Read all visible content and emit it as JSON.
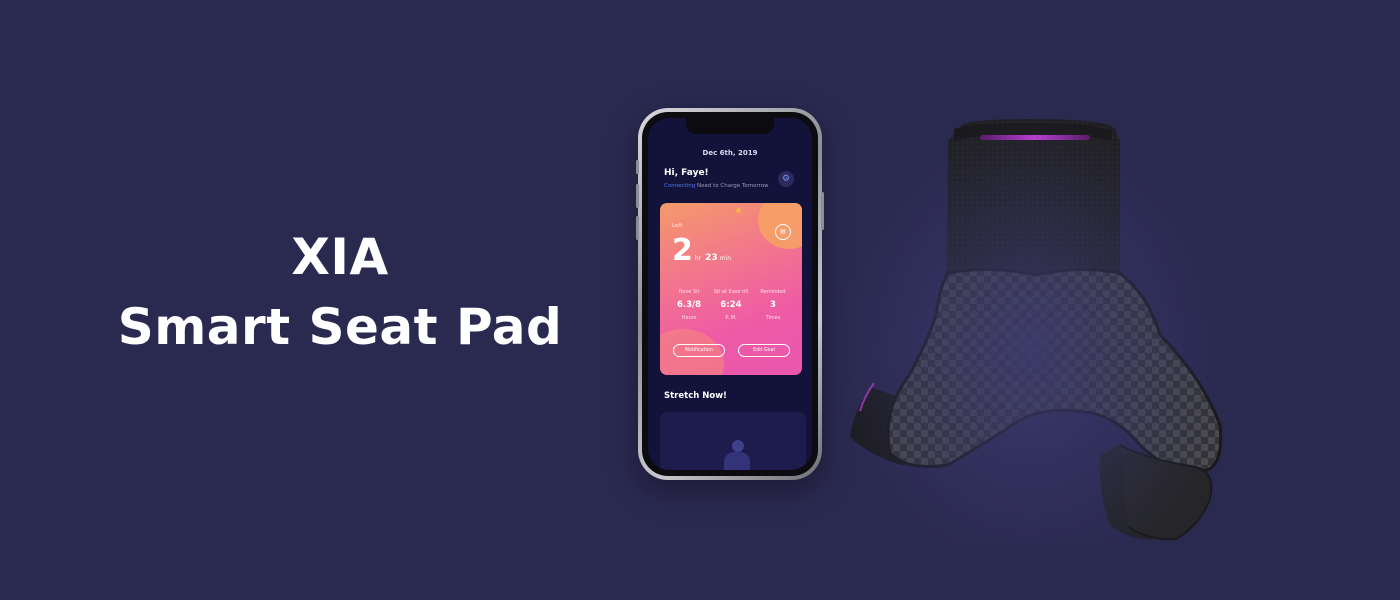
{
  "hero": {
    "line1": "XIA",
    "line2": "Smart Seat Pad"
  },
  "colors": {
    "background": "#2a2950",
    "screen": "#13123a",
    "card_gradient_start": "#f49a6a",
    "card_gradient_end": "#e957ad",
    "accent_blue": "#4d7cf0",
    "seat_glow": "#b03fc7"
  },
  "phone": {
    "date": "Dec 6th, 2019",
    "greeting": "Hi, Faye!",
    "status_connecting": "Connecting",
    "status_message": "Need to Charge Tomorrow",
    "settings_icon": "gear-icon",
    "card": {
      "left_label": "Left",
      "hours": "2",
      "hours_unit": "hr",
      "minutes": "23",
      "minutes_unit": "min",
      "calendar_icon": "calendar-icon",
      "stats": [
        {
          "label": "Have Sit",
          "value": "6.3/8",
          "sub": "Hours"
        },
        {
          "label": "Sit at Ease till",
          "value": "6:24",
          "sub": "P. M."
        },
        {
          "label": "Reminded",
          "value": "3",
          "sub": "Times"
        }
      ],
      "notification_label": "Notification",
      "edit_goal_label": "Edit Goal"
    },
    "stretch_title": "Stretch Now!"
  }
}
